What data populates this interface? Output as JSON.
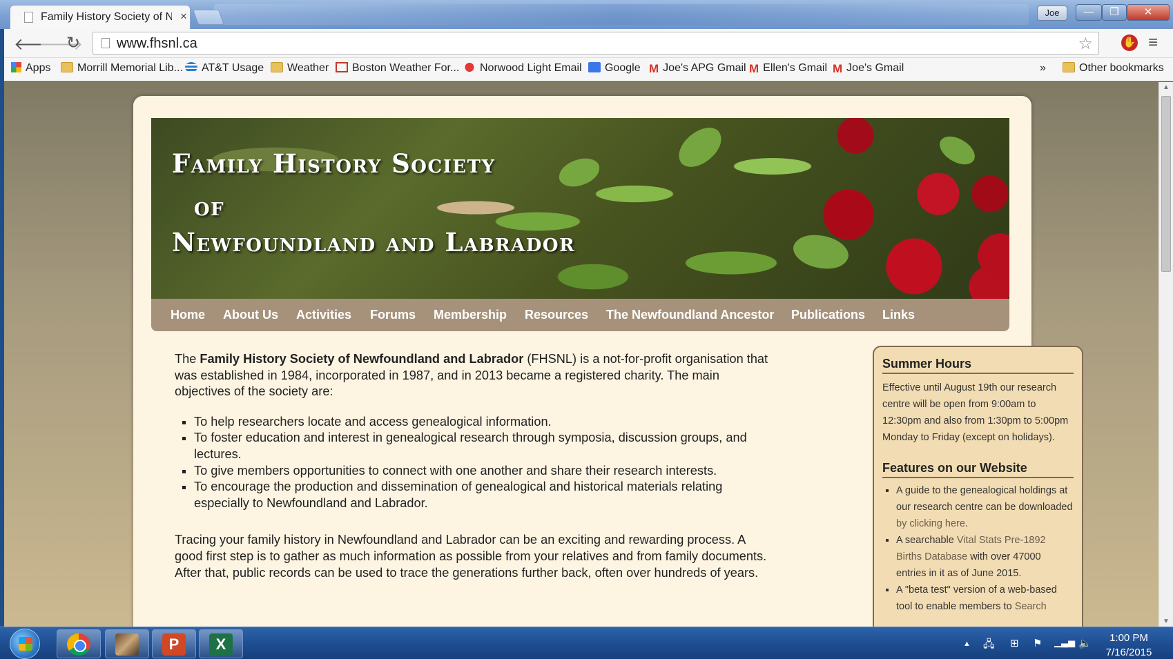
{
  "browser": {
    "tab_title": "Family History Society of N",
    "tab_close": "×",
    "user_label": "Joe",
    "url": "www.fhsnl.ca",
    "win_min": "—",
    "win_max": "❐",
    "win_close": "✕"
  },
  "bookmarks": [
    {
      "label": "Apps",
      "icon": "apps-grid-icon"
    },
    {
      "label": "Morrill Memorial Lib...",
      "icon": "folder-icon"
    },
    {
      "label": "AT&T Usage",
      "icon": "att-globe-icon"
    },
    {
      "label": "Weather",
      "icon": "folder-icon"
    },
    {
      "label": "Boston Weather For...",
      "icon": "weather-site-icon"
    },
    {
      "label": "Norwood Light Email",
      "icon": "norwood-light-icon"
    },
    {
      "label": "Google",
      "icon": "google-icon"
    },
    {
      "label": "Joe's APG Gmail",
      "icon": "gmail-icon"
    },
    {
      "label": "Ellen's Gmail",
      "icon": "gmail-icon"
    },
    {
      "label": "Joe's Gmail",
      "icon": "gmail-icon"
    }
  ],
  "bookmarks_overflow": "»",
  "other_bookmarks": "Other bookmarks",
  "site": {
    "banner_line1": "Family History Society",
    "banner_line2": "of",
    "banner_line3": "Newfoundland and Labrador",
    "nav": [
      "Home",
      "About Us",
      "Activities",
      "Forums",
      "Membership",
      "Resources",
      "The Newfoundland Ancestor",
      "Publications",
      "Links"
    ],
    "intro_pre": "The ",
    "intro_bold": "Family History Society of Newfoundland and Labrador",
    "intro_post": " (FHSNL) is a not-for-profit organisation that was established in 1984, incorporated in 1987, and in 2013 became a registered charity. The main objectives of the society are:",
    "objectives": [
      "To help researchers locate and access genealogical information.",
      "To foster education and interest in genealogical research through symposia, discussion groups, and lectures.",
      "To give members opportunities to connect with one another and share their research interests.",
      "To encourage the production and dissemination of genealogical and historical materials relating especially to Newfoundland and Labrador."
    ],
    "tracing": "Tracing your family history in Newfoundland and Labrador can be an exciting and rewarding process. A good first step is to gather as much information as possible from your relatives and from family documents. After that, public records can be used to trace the generations further back, often over hundreds of years."
  },
  "sidebar": {
    "hours_title": "Summer Hours",
    "hours_text": "Effective until August 19th our research centre will be open from 9:00am to 12:30pm and also from 1:30pm to 5:00pm Monday to Friday (except on holidays).",
    "features_title": "Features on our Website",
    "feature1_pre": "A guide to the genealogical holdings at our research centre can be downloaded ",
    "feature1_link": "by clicking here",
    "feature1_post": ".",
    "feature2_pre": "A searchable ",
    "feature2_link": "Vital Stats Pre-1892 Births Database",
    "feature2_post": " with over 47000 entries in it as of June 2015.",
    "feature3_pre": "A \"beta test\" version of a web-based tool to enable members to ",
    "feature3_link": "Search"
  },
  "taskbar": {
    "time": "1:00 PM",
    "date": "7/16/2015",
    "ppt_letter": "P",
    "xls_letter": "X"
  }
}
